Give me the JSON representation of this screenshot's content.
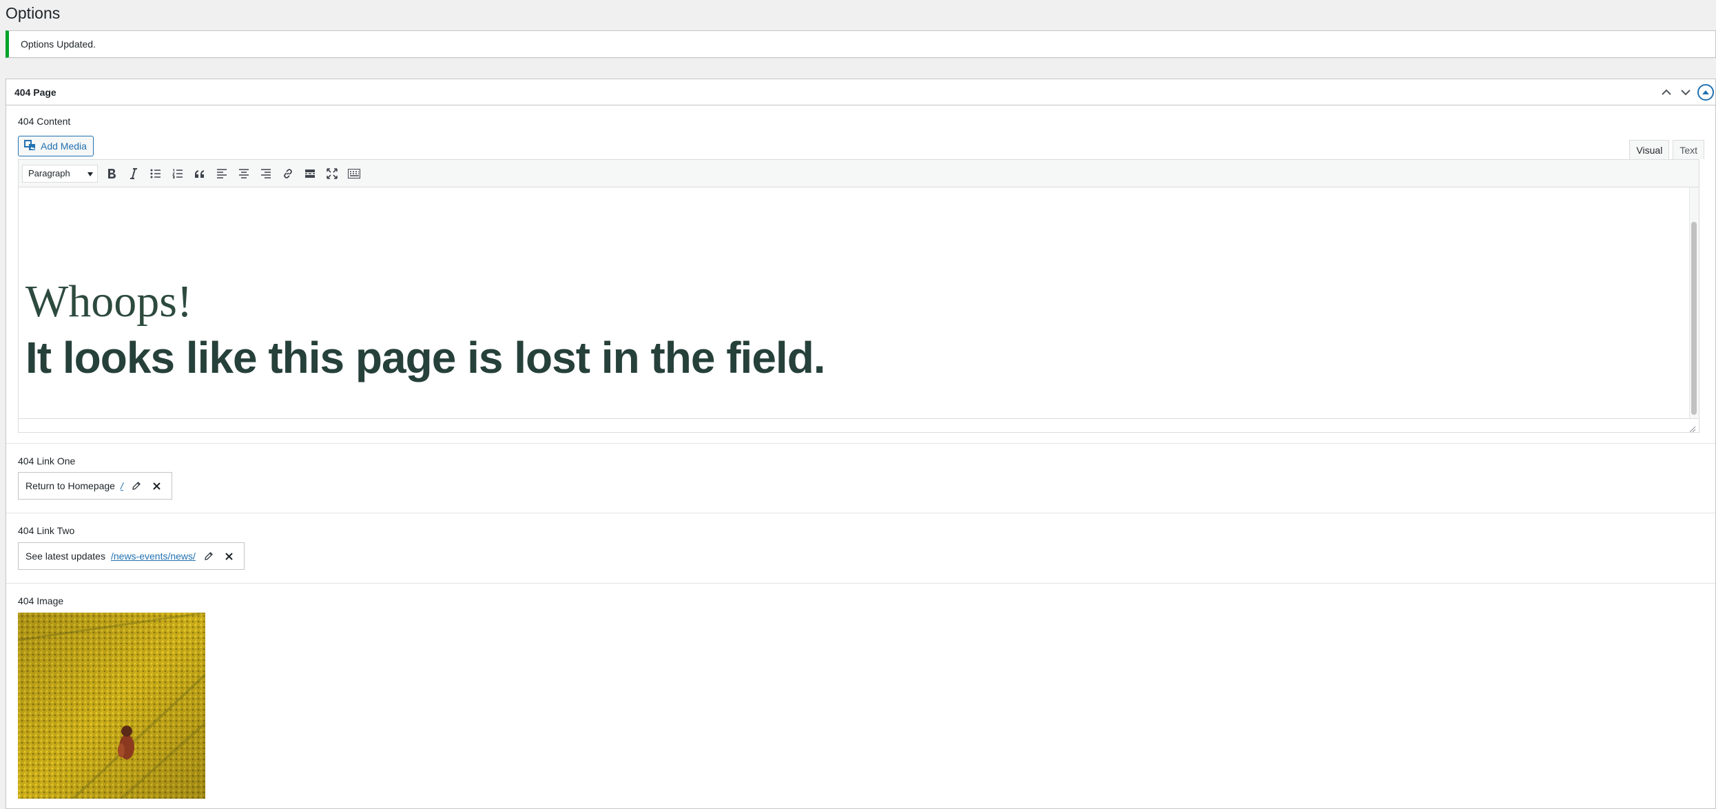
{
  "page": {
    "title": "Options"
  },
  "notice": {
    "text": "Options Updated."
  },
  "postbox": {
    "title": "404 Page",
    "actions": [
      "move-up-icon",
      "move-down-icon",
      "toggle-panel-icon"
    ]
  },
  "editor": {
    "label": "404 Content",
    "add_media_label": "Add Media",
    "tabs": {
      "visual": "Visual",
      "text": "Text",
      "active": "Visual"
    },
    "format_select": "Paragraph",
    "toolbar_icons": [
      "bold-icon",
      "italic-icon",
      "bulleted-list-icon",
      "numbered-list-icon",
      "blockquote-icon",
      "align-left-icon",
      "align-center-icon",
      "align-right-icon",
      "link-icon",
      "read-more-icon",
      "fullscreen-icon",
      "toolbar-toggle-icon"
    ],
    "content": {
      "heading": "Whoops!",
      "subheading": "It looks like this page is lost in the field."
    }
  },
  "link_one": {
    "label": "404 Link One",
    "title": "Return to Homepage",
    "url": "/"
  },
  "link_two": {
    "label": "404 Link Two",
    "title": "See latest updates",
    "url": "/news-events/news/"
  },
  "image_field": {
    "label": "404 Image"
  },
  "colors": {
    "accent": "#2271b1",
    "success": "#00a32a",
    "heading_text": "#2d4a3e",
    "field_image": "#c9a81c"
  }
}
